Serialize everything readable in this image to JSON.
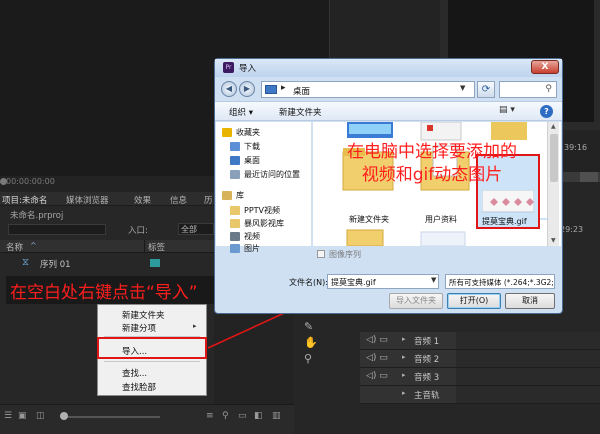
{
  "monitor": {
    "timecode": "00:00:00:00"
  },
  "project": {
    "tabs": [
      "项目:未命名",
      "媒体浏览器",
      "效果",
      "信息",
      "历"
    ],
    "filename": "未命名.prproj",
    "entry_label": "入口:",
    "entry_value": "全部",
    "col_name": "名称",
    "col_sort": "^",
    "col_label": "标签",
    "sequence_name": "序列 01",
    "sequence_color": "#2d9b9b"
  },
  "context_menu": {
    "items": [
      "新建文件夹",
      "新建分项",
      "导入...",
      "查找...",
      "查找脸部"
    ],
    "submenu_arrow": "▸"
  },
  "dialog": {
    "title": "导入",
    "close_symbol": "X",
    "address": "桌面",
    "addr_sep": "▸",
    "toolbar": {
      "organize": "组织 ▾",
      "new_folder": "新建文件夹",
      "view": "▤ ▾",
      "help": "?"
    },
    "nav_items": [
      {
        "label": "收藏夹",
        "color": "#e8b400"
      },
      {
        "label": "下载",
        "color": "#5c8fd6"
      },
      {
        "label": "桌面",
        "color": "#3f78c5"
      },
      {
        "label": "最近访问的位置",
        "color": "#8aa0b8"
      },
      {
        "label": "库",
        "color": "#d8b25a"
      },
      {
        "label": "PPTV视频",
        "color": "#e8c86a"
      },
      {
        "label": "暴风影视库",
        "color": "#e8c86a"
      },
      {
        "label": "视频",
        "color": "#6a7a8a"
      },
      {
        "label": "图片",
        "color": "#6a9ad0"
      }
    ],
    "files": [
      {
        "label": "新建文件夹",
        "kind": "folder"
      },
      {
        "label": "用户资料",
        "kind": "folder"
      },
      {
        "label": "提莫宝典.gif",
        "kind": "gif"
      }
    ],
    "image_sequence": "图像序列",
    "filename_label": "文件名(N):",
    "filename_value": "提莫宝典.gif",
    "filetype_value": "所有可支持媒体 (*.264;*.3G2;*",
    "btn_import_folder": "导入文件夹",
    "btn_open": "打开(O)",
    "btn_cancel": "取消"
  },
  "timeline": {
    "time1": "39:16",
    "time2": "29:23",
    "tracks": [
      {
        "name": "音频 1"
      },
      {
        "name": "音频 2"
      },
      {
        "name": "音频 3"
      },
      {
        "name": "主音轨"
      }
    ]
  },
  "annotations": {
    "left": "在空白处右键点击“导入”",
    "dialog_line1": "在电脑中选择要添加的",
    "dialog_line2": "视频和gif动态图片",
    "color": "#ff1e1e"
  }
}
